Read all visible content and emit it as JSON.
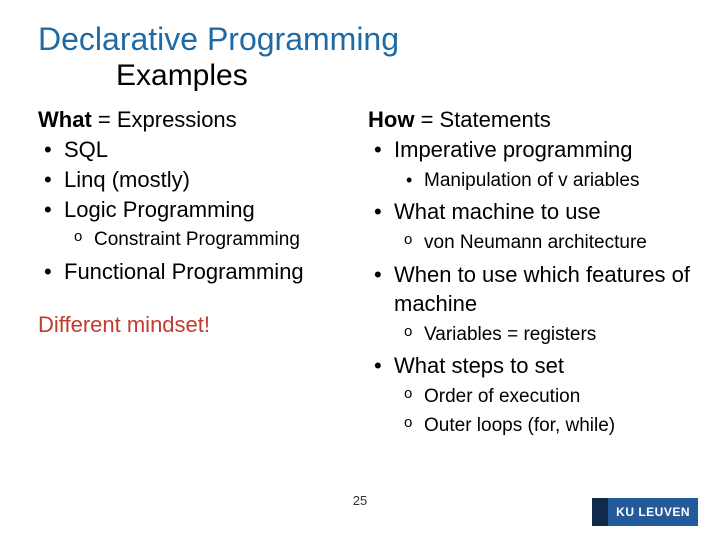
{
  "title": "Declarative Programming",
  "subtitle": "Examples",
  "left": {
    "head_word": "What",
    "head_rest": " = Expressions",
    "items": {
      "a": "SQL",
      "b": "Linq (mostly)",
      "c": "Logic Programming",
      "c_sub": "Constraint Programming",
      "d": "Functional Programming"
    },
    "mindset": "Different mindset!"
  },
  "right": {
    "head_word": "How",
    "head_rest": " = Statements",
    "items": {
      "a": "Imperative programming",
      "a_sub": "Manipulation of v ariables",
      "b": "What machine to use",
      "b_sub": "von Neumann architecture",
      "c": "When to use which features of machine",
      "c_sub": "Variables = registers",
      "d": "What steps to set",
      "d_sub1": "Order of execution",
      "d_sub2": "Outer loops (for, while)"
    }
  },
  "page_number": "25",
  "logo_text": "KU LEUVEN"
}
